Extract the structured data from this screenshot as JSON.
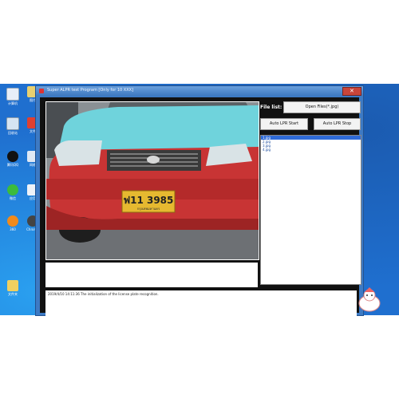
{
  "window": {
    "title": "Super ALPR test Program   [Only for 10 XXX]"
  },
  "file_list": {
    "label": "File list:",
    "open_button": "Open Files(*.jpg)",
    "start_button": "Auto LPR Start",
    "stop_button": "Auto LPR Stop",
    "items": [
      "1.jpg",
      "2.jpg",
      "3.jpg",
      "4.jpg"
    ]
  },
  "log": {
    "line": "2019/4/10 14:11:36 The initialization of the license plate recognition."
  },
  "photo": {
    "plate_text": "ฟ11 3985",
    "plate_sub": "กรุงเทพมหานคร"
  },
  "desktop": {
    "icons": [
      "计算机",
      "回收站",
      "腾讯QQ",
      "微信",
      "360",
      "图片",
      "文件",
      "网络",
      "应用",
      "Chrome",
      "文件夹"
    ]
  },
  "colors": {
    "desktop": "#1f6fcf",
    "car_body": "#c83434",
    "car_roof": "#6fd3dc",
    "plate": "#e6b930",
    "selection": "#2f6bd8"
  }
}
